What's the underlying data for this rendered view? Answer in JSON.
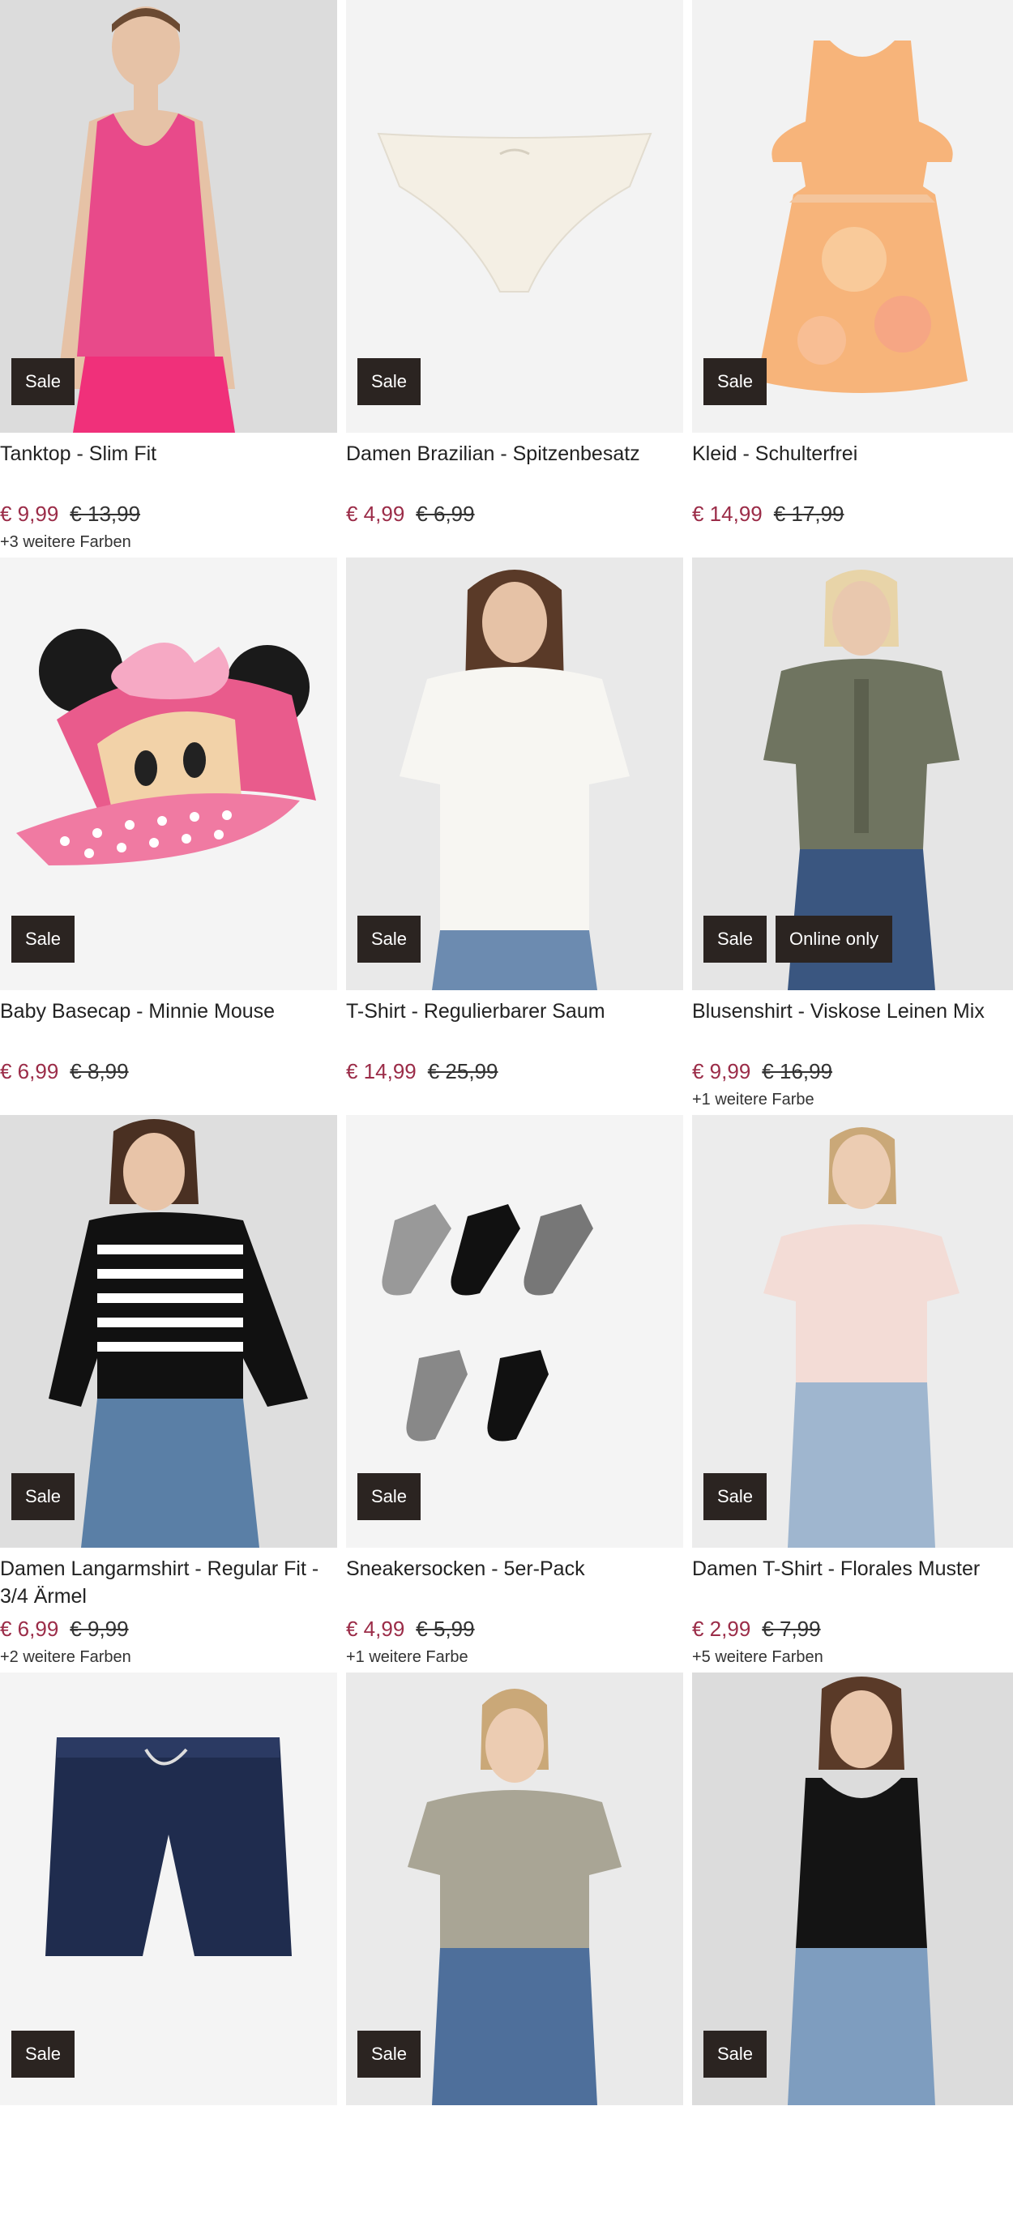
{
  "badges": {
    "sale": "Sale",
    "online_only": "Online only"
  },
  "products": [
    {
      "title": "Tanktop - Slim Fit",
      "price": "€ 9,99",
      "old_price": "€ 13,99",
      "colors": "+3 weitere Farben"
    },
    {
      "title": "Damen Brazilian - Spitzenbesatz",
      "price": "€ 4,99",
      "old_price": "€ 6,99",
      "colors": ""
    },
    {
      "title": "Kleid - Schulterfrei",
      "price": "€ 14,99",
      "old_price": "€ 17,99",
      "colors": ""
    },
    {
      "title": "Baby Basecap - Minnie Mouse",
      "price": "€ 6,99",
      "old_price": "€ 8,99",
      "colors": ""
    },
    {
      "title": "T-Shirt - Regulierbarer Saum",
      "price": "€ 14,99",
      "old_price": "€ 25,99",
      "colors": ""
    },
    {
      "title": "Blusenshirt - Viskose Leinen Mix",
      "price": "€ 9,99",
      "old_price": "€ 16,99",
      "colors": "+1 weitere Farbe"
    },
    {
      "title": "Damen Langarmshirt - Regular Fit - 3/4 Ärmel",
      "price": "€ 6,99",
      "old_price": "€ 9,99",
      "colors": "+2 weitere Farben"
    },
    {
      "title": "Sneakersocken - 5er-Pack",
      "price": "€ 4,99",
      "old_price": "€ 5,99",
      "colors": "+1 weitere Farbe"
    },
    {
      "title": "Damen T-Shirt - Florales Muster",
      "price": "€ 2,99",
      "old_price": "€ 7,99",
      "colors": "+5 weitere Farben"
    },
    {
      "title": "",
      "price": "",
      "old_price": "",
      "colors": ""
    },
    {
      "title": "",
      "price": "",
      "old_price": "",
      "colors": ""
    },
    {
      "title": "",
      "price": "",
      "old_price": "",
      "colors": ""
    }
  ],
  "colors": {
    "sale_price": "#9b2c48",
    "badge_bg": "#2b2421"
  }
}
